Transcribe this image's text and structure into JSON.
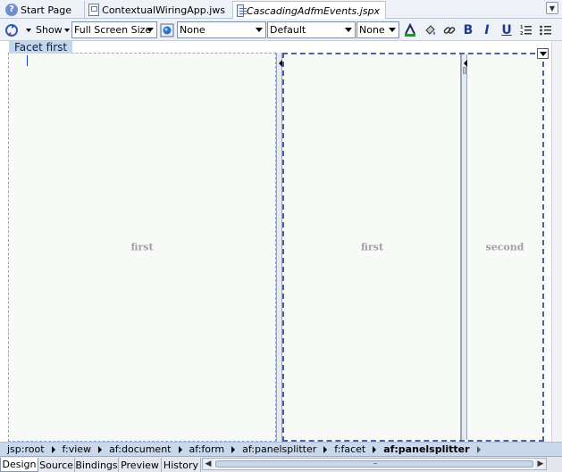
{
  "tabs": [
    {
      "label": "Start Page",
      "icon": "start-page-icon"
    },
    {
      "label": "ContextualWiringApp.jws",
      "icon": "workspace-icon"
    },
    {
      "label": "CascadingAdfmEvents.jspx",
      "icon": "jspx-file-icon",
      "active": true
    }
  ],
  "toolbar": {
    "show_label": "Show",
    "screen_size": "Full Screen Size",
    "style_class": "None",
    "font_family": "Default",
    "font_size": "None",
    "bold_glyph": "B",
    "italic_glyph": "I",
    "underline_glyph": "U"
  },
  "canvas": {
    "facet_label": "Facet  first",
    "panes": {
      "left_label": "first",
      "inner_first_label": "first",
      "inner_second_label": "second"
    }
  },
  "breadcrumb": [
    "jsp:root",
    "f:view",
    "af:document",
    "af:form",
    "af:panelsplitter",
    "f:facet",
    "af:panelsplitter"
  ],
  "bottom_tabs": [
    "Design",
    "Source",
    "Bindings",
    "Preview",
    "History"
  ],
  "active_bottom_tab": "Design",
  "colors": {
    "accent": "#1f3c8c",
    "selection_border": "#4a63a8",
    "facet_label_bg": "#c4d6ec",
    "breadcrumb_bg": "#c9d8ec"
  }
}
